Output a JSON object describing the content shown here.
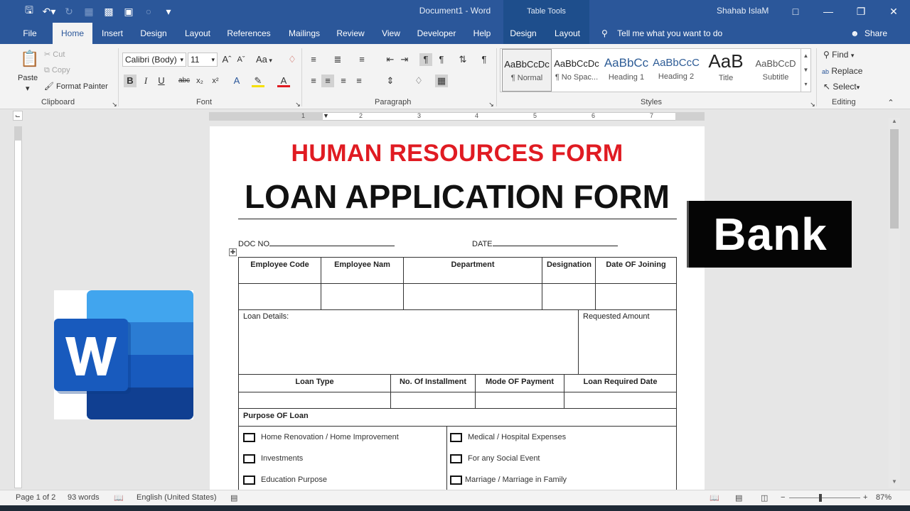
{
  "window": {
    "title": "Document1  -  Word",
    "table_tools": "Table Tools",
    "user": "Shahab IslaM"
  },
  "tabs": [
    "File",
    "Home",
    "Insert",
    "Design",
    "Layout",
    "References",
    "Mailings",
    "Review",
    "View",
    "Developer",
    "Help",
    "Design",
    "Layout"
  ],
  "tell_me": "Tell me what you want to do",
  "share": "Share",
  "ribbon": {
    "clipboard": {
      "label": "Clipboard",
      "paste": "Paste",
      "cut": "Cut",
      "copy": "Copy",
      "format_painter": "Format Painter"
    },
    "font": {
      "label": "Font",
      "font_name": "Calibri (Body)",
      "font_size": "11",
      "case": "Aa"
    },
    "paragraph": {
      "label": "Paragraph"
    },
    "styles": {
      "label": "Styles",
      "items": [
        {
          "preview": "AaBbCcDc",
          "name": "¶ Normal"
        },
        {
          "preview": "AaBbCcDc",
          "name": "¶ No Spac..."
        },
        {
          "preview": "AaBbCc",
          "name": "Heading 1"
        },
        {
          "preview": "AaBbCcC",
          "name": "Heading 2"
        },
        {
          "preview": "AaB",
          "name": "Title"
        },
        {
          "preview": "AaBbCcD",
          "name": "Subtitle"
        }
      ]
    },
    "editing": {
      "label": "Editing",
      "find": "Find",
      "replace": "Replace",
      "select": "Select"
    }
  },
  "ruler": {
    "numbers": [
      "1",
      "2",
      "3",
      "4",
      "5",
      "6",
      "7"
    ]
  },
  "document": {
    "heading_red": "HUMAN RESOURCES FORM",
    "heading_main": "LOAN APPLICATION FORM",
    "doc_no": "DOC NO",
    "date": "DATE",
    "table": {
      "row1_headers": [
        "Employee Code",
        "Employee Nam",
        "Department",
        "Designation",
        "Date OF Joining"
      ],
      "loan_details": "Loan Details:",
      "requested_amount": "Requested Amount",
      "row3_headers": [
        "Loan Type",
        "No. Of Installment",
        "Mode OF Payment",
        "Loan Required Date"
      ],
      "purpose_heading": "Purpose OF Loan",
      "purpose_left": [
        "Home Renovation / Home Improvement",
        "Investments",
        "Education Purpose"
      ],
      "purpose_right": [
        "Medical / Hospital Expenses",
        "For any Social Event",
        "Marriage / Marriage in Family"
      ]
    }
  },
  "bank_label": "Bank",
  "status": {
    "page": "Page 1 of 2",
    "words": "93 words",
    "language": "English (United States)",
    "zoom": "87%"
  },
  "colors": {
    "accent": "#2b579a",
    "heading_red": "#e01b22"
  }
}
